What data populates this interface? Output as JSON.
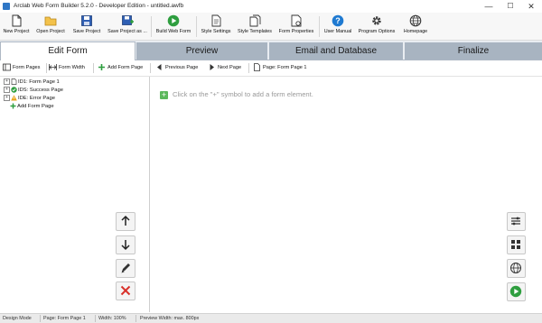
{
  "window": {
    "title": "Arclab Web Form Builder 5.2.0 - Developer Edition - untitled.awfb",
    "minimize": "—",
    "maximize": "☐",
    "close": "✕"
  },
  "toolbar": {
    "new_project": "New Project",
    "open_project": "Open Project",
    "save_project": "Save Project",
    "save_project_as": "Save Project as ...",
    "build_web_form": "Build Web Form",
    "style_settings": "Style Settings",
    "style_templates": "Style Templates",
    "form_properties": "Form Properties",
    "user_manual": "User Manual",
    "program_options": "Program Options",
    "homepage": "Homepage"
  },
  "tabs": {
    "edit_form": "Edit Form",
    "preview": "Preview",
    "email_database": "Email and Database",
    "finalize": "Finalize"
  },
  "subbar": {
    "form_pages": "Form Pages",
    "form_width": "Form Width",
    "add_form_page": "Add Form Page",
    "previous_page": "Previous Page",
    "next_page": "Next Page",
    "current_page": "Page: Form Page 1"
  },
  "tree": {
    "items": [
      {
        "label": "ID1: Form Page 1"
      },
      {
        "label": "IDS: Success Page"
      },
      {
        "label": "IDE: Error Page"
      },
      {
        "label": "Add Form Page"
      }
    ]
  },
  "editor": {
    "hint": "Click on the \"+\" symbol to add a form element."
  },
  "status": {
    "mode": "Design Mode",
    "page": "Page: Form Page 1",
    "width": "Width: 100%",
    "preview_width": "Preview Width: max. 800px"
  },
  "colors": {
    "tab_active": "#ffffff",
    "tab_inactive": "#a8b4c1",
    "add_green": "#5cb85c",
    "delete_red": "#d9312b",
    "build_green": "#2e9e3f",
    "help_blue": "#1f7ad1"
  }
}
